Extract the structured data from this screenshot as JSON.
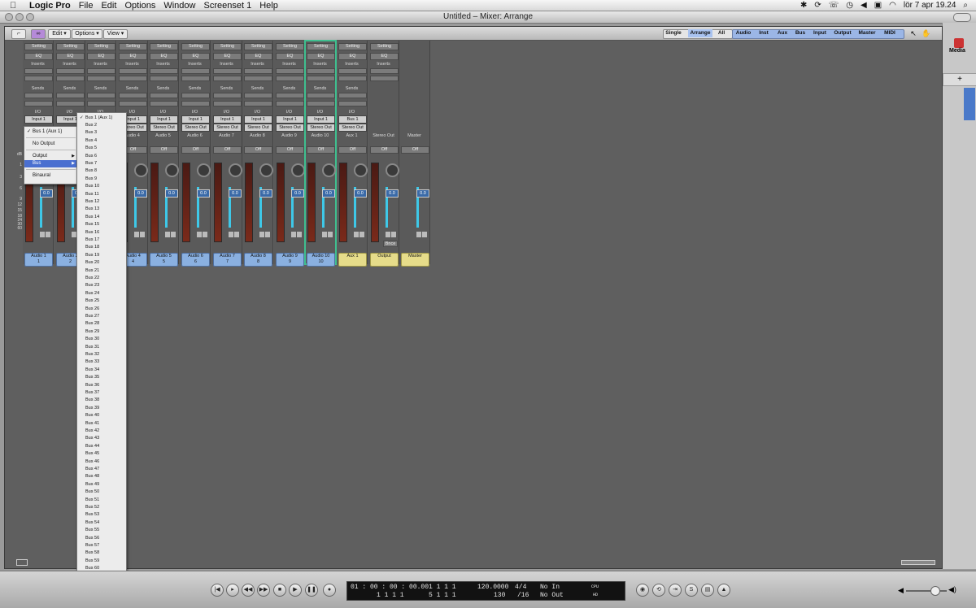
{
  "menubar": {
    "app": "Logic Pro",
    "items": [
      "File",
      "Edit",
      "Options",
      "Window",
      "Screenset 1",
      "Help"
    ],
    "clock": "lör 7 apr  19.24"
  },
  "window": {
    "title": "Untitled – Mixer: Arrange"
  },
  "media": {
    "label": "Media"
  },
  "toolbar": {
    "edit": "Edit ▾",
    "options": "Options ▾",
    "view": "View ▾",
    "view_tabs": [
      "Single",
      "Arrange",
      "All"
    ],
    "filter_tabs": [
      "Audio",
      "Inst",
      "Aux",
      "Bus",
      "Input",
      "Output",
      "Master",
      "MIDI"
    ]
  },
  "labels": {
    "setting": "Setting",
    "eq": "EQ",
    "inserts": "Inserts",
    "sends": "Sends",
    "io": "I/O",
    "off": "Off"
  },
  "strips": [
    {
      "input": "Input 1",
      "output": "",
      "name": "Audio 1",
      "num": "1",
      "fader": "0.0",
      "color": "blue"
    },
    {
      "input": "Input 1",
      "output": "",
      "name": "Audio 2",
      "num": "2",
      "fader": "0.0",
      "color": "blue"
    },
    {
      "input": "",
      "output": "",
      "name": "",
      "num": "",
      "fader": "",
      "color": "blue"
    },
    {
      "input": "Input 1",
      "output": "Stereo Out",
      "name": "Audio 4",
      "num": "4",
      "fader": "0.0",
      "color": "blue"
    },
    {
      "input": "Input 1",
      "output": "Stereo Out",
      "name": "Audio 5",
      "num": "5",
      "fader": "0.0",
      "color": "blue"
    },
    {
      "input": "Input 1",
      "output": "Stereo Out",
      "name": "Audio 6",
      "num": "6",
      "fader": "0.0",
      "color": "blue"
    },
    {
      "input": "Input 1",
      "output": "Stereo Out",
      "name": "Audio 7",
      "num": "7",
      "fader": "0.0",
      "color": "blue"
    },
    {
      "input": "Input 1",
      "output": "Stereo Out",
      "name": "Audio 8",
      "num": "8",
      "fader": "0.0",
      "color": "blue"
    },
    {
      "input": "Input 1",
      "output": "Stereo Out",
      "name": "Audio 9",
      "num": "9",
      "fader": "0.0",
      "color": "blue"
    },
    {
      "input": "Input 1",
      "output": "Stereo Out",
      "name": "Audio 10",
      "num": "10",
      "fader": "0.0",
      "color": "blue"
    },
    {
      "input": "Bus 1",
      "output": "Stereo Out",
      "name": "Aux 1",
      "num": "",
      "fader": "0.0",
      "color": "yellow"
    },
    {
      "input": "",
      "output": "",
      "name": "Output",
      "num": "",
      "fader": "0.0",
      "color": "yellow",
      "label": "Stereo Out",
      "extra": "Bnce"
    },
    {
      "input": "",
      "output": "",
      "name": "Master",
      "num": "",
      "fader": "0.0",
      "color": "yellow",
      "label": "Master"
    }
  ],
  "scale": [
    "dB",
    "1",
    "3",
    "6",
    "9",
    "12",
    "15",
    "18",
    "24",
    "30",
    "60"
  ],
  "popup": {
    "items": [
      {
        "label": "Bus 1  (Aux 1)",
        "checked": true
      },
      {
        "label": "No Output"
      },
      {
        "label": "Output",
        "submenu": true
      },
      {
        "label": "Bus",
        "submenu": true,
        "highlight": true
      },
      {
        "label": "Binaural"
      }
    ]
  },
  "bus_list": {
    "first": "Bus 1  (Aux 1)",
    "others": [
      "Bus 2",
      "Bus 3",
      "Bus 4",
      "Bus 5",
      "Bus 6",
      "Bus 7",
      "Bus 8",
      "Bus 9",
      "Bus 10",
      "Bus 11",
      "Bus 12",
      "Bus 13",
      "Bus 14",
      "Bus 15",
      "Bus 16",
      "Bus 17",
      "Bus 18",
      "Bus 19",
      "Bus 20",
      "Bus 21",
      "Bus 22",
      "Bus 23",
      "Bus 24",
      "Bus 25",
      "Bus 26",
      "Bus 27",
      "Bus 28",
      "Bus 29",
      "Bus 30",
      "Bus 31",
      "Bus 32",
      "Bus 33",
      "Bus 34",
      "Bus 35",
      "Bus 36",
      "Bus 37",
      "Bus 38",
      "Bus 39",
      "Bus 40",
      "Bus 41",
      "Bus 42",
      "Bus 43",
      "Bus 44",
      "Bus 45",
      "Bus 46",
      "Bus 47",
      "Bus 48",
      "Bus 49",
      "Bus 50",
      "Bus 51",
      "Bus 52",
      "Bus 53",
      "Bus 54",
      "Bus 55",
      "Bus 56",
      "Bus 57",
      "Bus 58",
      "Bus 59",
      "Bus 60",
      "Bus 61",
      "Bus 62",
      "Bus 63",
      "Bus 64"
    ]
  },
  "transport": {
    "smpte": "01 : 00 : 00 : 00.00",
    "smpte_sub": "1    1    1    1",
    "bars": "1    1    1    1",
    "bars_sub": "5    1    1    1",
    "tempo": "120.0000",
    "tempo_sub": "130",
    "sig": "4/4",
    "div": "/16",
    "in": "No In",
    "out": "No Out",
    "cpu": "CPU",
    "hd": "HD"
  }
}
